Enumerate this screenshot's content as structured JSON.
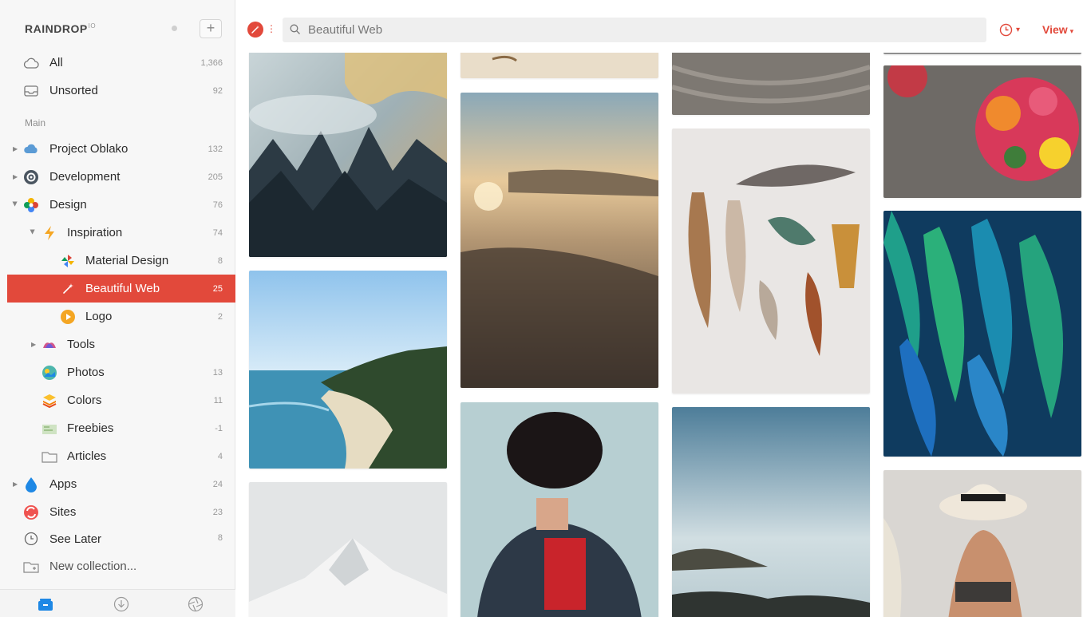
{
  "app": {
    "brand": "RAINDROP",
    "brand_suffix": "IO",
    "add_symbol": "+"
  },
  "sidebar": {
    "section_main": "Main",
    "items": [
      {
        "label": "All",
        "count": "1,366",
        "icon": "cloud-outline-icon"
      },
      {
        "label": "Unsorted",
        "count": "92",
        "icon": "inbox-icon"
      },
      {
        "label": "Project Oblako",
        "count": "132",
        "icon": "cloud-icon"
      },
      {
        "label": "Development",
        "count": "205",
        "icon": "gear-icon"
      },
      {
        "label": "Design",
        "count": "76",
        "icon": "flower-icon"
      },
      {
        "label": "Inspiration",
        "count": "74",
        "icon": "lightning-icon"
      },
      {
        "label": "Material Design",
        "count": "8",
        "icon": "pinwheel-icon"
      },
      {
        "label": "Beautiful Web",
        "count": "25",
        "icon": "magic-wand-icon",
        "active": true
      },
      {
        "label": "Logo",
        "count": "2",
        "icon": "play-icon"
      },
      {
        "label": "Tools",
        "count": "",
        "icon": "tools-icon"
      },
      {
        "label": "Photos",
        "count": "13",
        "icon": "photos-icon"
      },
      {
        "label": "Colors",
        "count": "11",
        "icon": "layers-icon"
      },
      {
        "label": "Freebies",
        "count": "-1",
        "icon": "gift-icon"
      },
      {
        "label": "Articles",
        "count": "4",
        "icon": "folder-icon"
      },
      {
        "label": "Apps",
        "count": "24",
        "icon": "drop-icon"
      },
      {
        "label": "Sites",
        "count": "23",
        "icon": "sites-icon"
      },
      {
        "label": "See Later",
        "count": "8",
        "icon": "clock-icon"
      }
    ],
    "new_collection": "New collection..."
  },
  "topbar": {
    "search_value": "Beautiful Web",
    "view_label": "View",
    "accent": "#e2493b"
  },
  "colors": {
    "accent": "#e2493b",
    "sidebar_bg": "#f7f7f7"
  }
}
